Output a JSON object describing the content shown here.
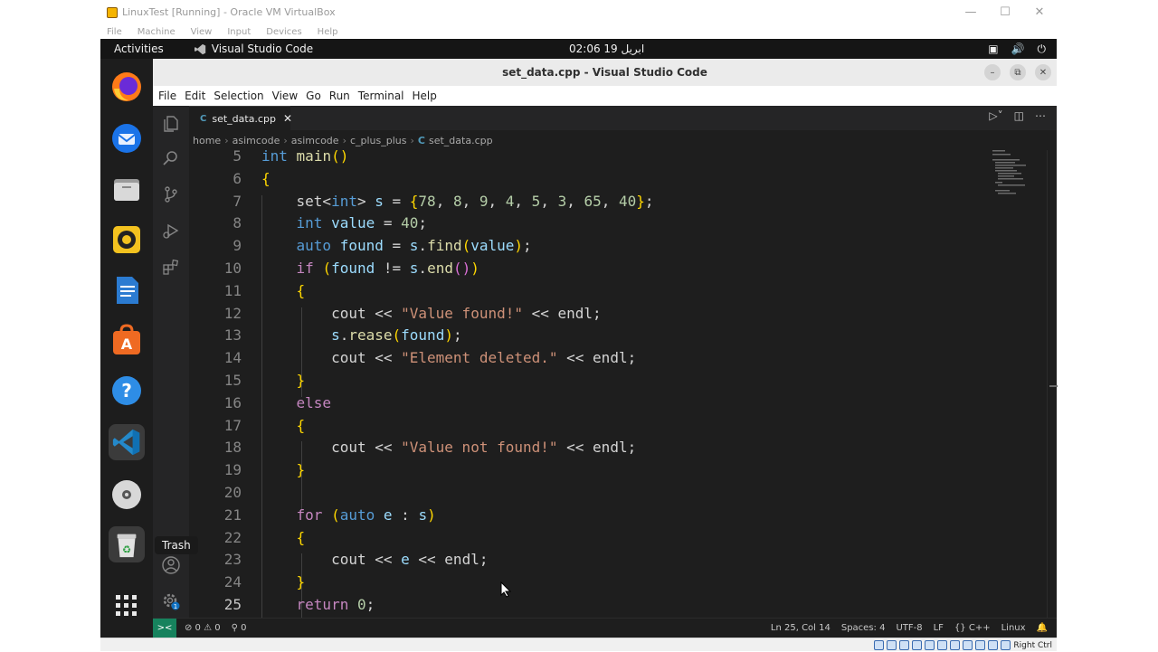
{
  "vbox": {
    "title": "LinuxTest [Running] - Oracle VM VirtualBox",
    "menu": [
      "File",
      "Machine",
      "View",
      "Input",
      "Devices",
      "Help"
    ],
    "host_key": "Right Ctrl"
  },
  "gnome": {
    "activities": "Activities",
    "app_name": "Visual Studio Code",
    "clock": "02:06  19 ابريل",
    "trash_tooltip": "Trash"
  },
  "dock": {
    "items": [
      "firefox-icon",
      "thunderbird-icon",
      "files-icon",
      "rhythmbox-icon",
      "libreoffice-writer-icon",
      "software-store-icon",
      "help-icon",
      "vscode-icon",
      "dvd-icon",
      "trash-icon",
      "show-apps-icon"
    ]
  },
  "vscode": {
    "title": "set_data.cpp - Visual Studio Code",
    "menu": [
      "File",
      "Edit",
      "Selection",
      "View",
      "Go",
      "Run",
      "Terminal",
      "Help"
    ],
    "tab": "set_data.cpp",
    "tab_icon": "C",
    "breadcrumb": [
      "home",
      "asimcode",
      "asimcode",
      "c_plus_plus",
      "set_data.cpp"
    ],
    "current_line": "25",
    "code_lines": [
      {
        "num": "5",
        "text": "int main()"
      },
      {
        "num": "6",
        "text": "{"
      },
      {
        "num": "7",
        "text": "    set<int> s = {78, 8, 9, 4, 5, 3, 65, 40};"
      },
      {
        "num": "8",
        "text": "    int value = 40;"
      },
      {
        "num": "9",
        "text": "    auto found = s.find(value);"
      },
      {
        "num": "10",
        "text": "    if (found != s.end())"
      },
      {
        "num": "11",
        "text": "    {"
      },
      {
        "num": "12",
        "text": "        cout << \"Value found!\" << endl;"
      },
      {
        "num": "13",
        "text": "        s.rease(found);"
      },
      {
        "num": "14",
        "text": "        cout << \"Element deleted.\" << endl;"
      },
      {
        "num": "15",
        "text": "    }"
      },
      {
        "num": "16",
        "text": "    else"
      },
      {
        "num": "17",
        "text": "    {"
      },
      {
        "num": "18",
        "text": "        cout << \"Value not found!\" << endl;"
      },
      {
        "num": "19",
        "text": "    }"
      },
      {
        "num": "20",
        "text": ""
      },
      {
        "num": "21",
        "text": "    for (auto e : s)"
      },
      {
        "num": "22",
        "text": "    {"
      },
      {
        "num": "23",
        "text": "        cout << e << endl;"
      },
      {
        "num": "24",
        "text": "    }"
      },
      {
        "num": "25",
        "text": "    return 0;"
      }
    ],
    "status": {
      "errors": "⊘ 0 ⚠ 0",
      "ports": "⚲ 0",
      "position": "Ln 25, Col 14",
      "spaces": "Spaces: 4",
      "encoding": "UTF-8",
      "eol": "LF",
      "language": "{} C++",
      "os": "Linux"
    }
  },
  "colors": {
    "editor_bg": "#1e1e1e",
    "keyword": "#569cd6",
    "control": "#c586c0",
    "function": "#dcdcaa",
    "variable": "#9cdcfe",
    "number": "#b5cea8",
    "string": "#ce9178",
    "remote": "#16825d"
  }
}
